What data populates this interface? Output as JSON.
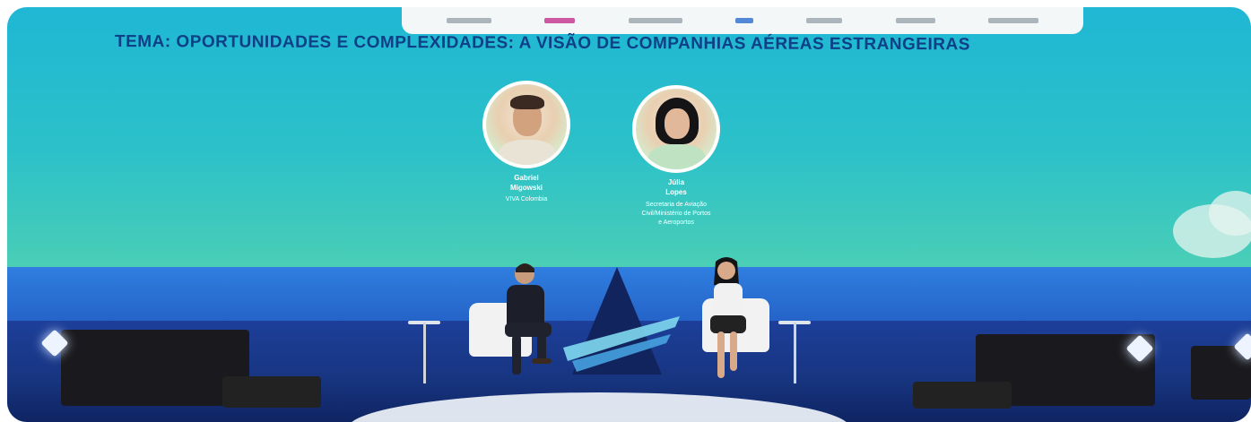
{
  "scene": {
    "theme_title": "TEMA: OPORTUNIDADES E COMPLEXIDADES: A VISÃO DE COMPANHIAS AÉREAS ESTRANGEIRAS",
    "speakers": [
      {
        "name_line1": "Gabriel",
        "name_line2": "Migowski",
        "role_line1": "VIVA Colombia",
        "role_line2": "",
        "role_line3": ""
      },
      {
        "name_line1": "Júlia",
        "name_line2": "Lopes",
        "role_line1": "Secretaria de Aviação",
        "role_line2": "Civil/Ministério de Portos",
        "role_line3": "e Aeroportos"
      }
    ],
    "sponsor_strip": "sponsor logos",
    "colors": {
      "screen_top": "#1fb7d4",
      "screen_mid": "#47cdb8",
      "title_blue": "#0f3f86",
      "stage_blue": "#2b6fcf",
      "floor_navy": "#17347f"
    }
  }
}
